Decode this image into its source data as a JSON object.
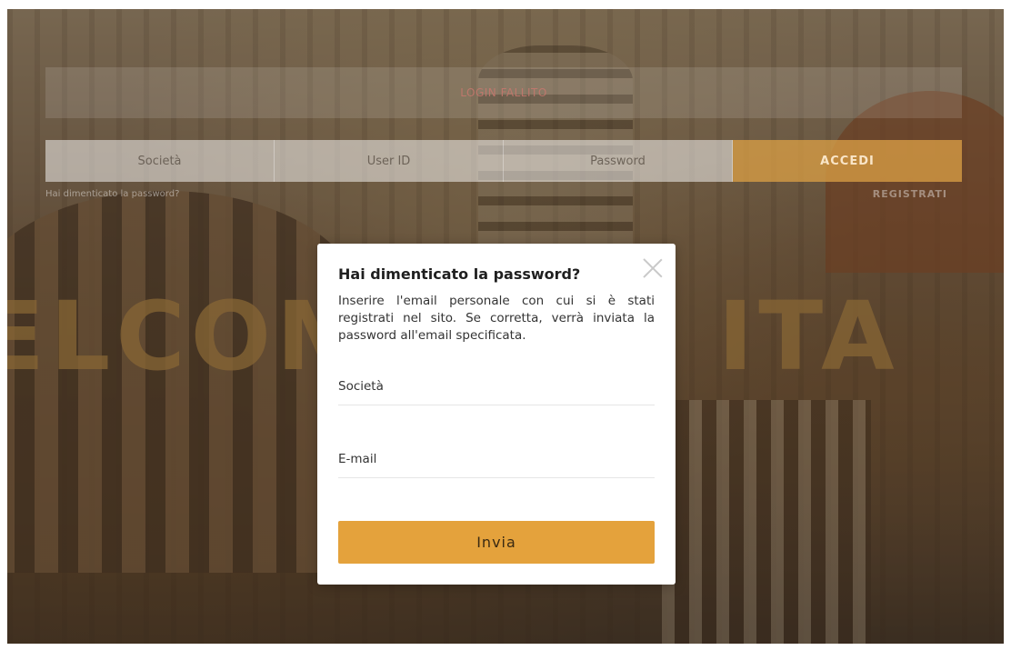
{
  "header": {
    "alert_text": "LOGIN FALLITO",
    "fields": [
      {
        "placeholder": "Società"
      },
      {
        "placeholder": "User ID"
      },
      {
        "placeholder": "Password"
      }
    ],
    "login_button": "ACCEDI",
    "forgot_link": "Hai dimenticato la password?",
    "register_link": "REGISTRATI"
  },
  "background": {
    "title": "ELCOME TO. ITA"
  },
  "modal": {
    "title": "Hai dimenticato la password?",
    "description": "Inserire l'email personale con cui si è stati registrati nel sito. Se corretta, verrà inviata la password all'email specificata.",
    "company_placeholder": "Società",
    "email_placeholder": "E-mail",
    "submit_label": "Invia"
  },
  "colors": {
    "accent": "#e4a23c",
    "modal_bg": "#ffffff"
  }
}
